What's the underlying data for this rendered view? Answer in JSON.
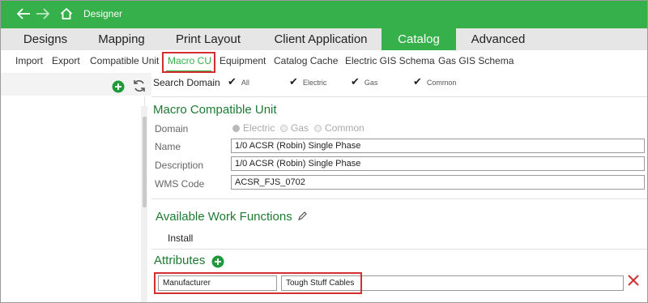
{
  "titlebar": {
    "back_icon": "arrow-left-icon",
    "forward_icon": "arrow-right-icon",
    "home_icon": "home-icon",
    "title": "Designer",
    "bg_color": "#35b04b"
  },
  "main_tabs": [
    {
      "label": "Designs",
      "active": false
    },
    {
      "label": "Mapping",
      "active": false
    },
    {
      "label": "Print Layout",
      "active": false
    },
    {
      "label": "Client Application",
      "active": false
    },
    {
      "label": "Catalog",
      "active": true
    },
    {
      "label": "Advanced",
      "active": false
    }
  ],
  "sub_tabs": [
    {
      "label": "Import",
      "active": false
    },
    {
      "label": "Export",
      "active": false
    },
    {
      "label": "Compatible Unit",
      "active": false
    },
    {
      "label": "Macro CU",
      "active": true
    },
    {
      "label": "Equipment",
      "active": false
    },
    {
      "label": "Catalog Cache",
      "active": false
    },
    {
      "label": "Electric GIS Schema",
      "active": false
    },
    {
      "label": "Gas GIS Schema",
      "active": false
    }
  ],
  "left_panel": {
    "add_icon": "plus-circle-icon",
    "refresh_icon": "refresh-icon"
  },
  "search_domain": {
    "label": "Search Domain",
    "options": [
      {
        "label": "All",
        "checked": true
      },
      {
        "label": "Electric",
        "checked": true
      },
      {
        "label": "Gas",
        "checked": true
      },
      {
        "label": "Common",
        "checked": true
      }
    ]
  },
  "macro_cu": {
    "section_title": "Macro Compatible Unit",
    "domain_label": "Domain",
    "domain_options": [
      {
        "label": "Electric",
        "selected": true
      },
      {
        "label": "Gas",
        "selected": false
      },
      {
        "label": "Common",
        "selected": false
      }
    ],
    "name_label": "Name",
    "name_value": "1/0 ACSR (Robin) Single Phase",
    "description_label": "Description",
    "description_value": "1/0 ACSR (Robin) Single Phase",
    "wms_label": "WMS Code",
    "wms_value": "ACSR_FJS_0702"
  },
  "work_functions": {
    "section_title": "Available Work Functions",
    "edit_icon": "pencil-icon",
    "items": [
      "Install"
    ]
  },
  "attributes": {
    "section_title": "Attributes",
    "add_icon": "plus-circle-icon",
    "rows": [
      {
        "name": "Manufacturer",
        "value": "Tough Stuff Cables",
        "delete_icon": "close-icon"
      }
    ]
  },
  "colors": {
    "accent": "#35b04b",
    "section_title": "#1e7a33",
    "highlight": "#d32f2f"
  }
}
